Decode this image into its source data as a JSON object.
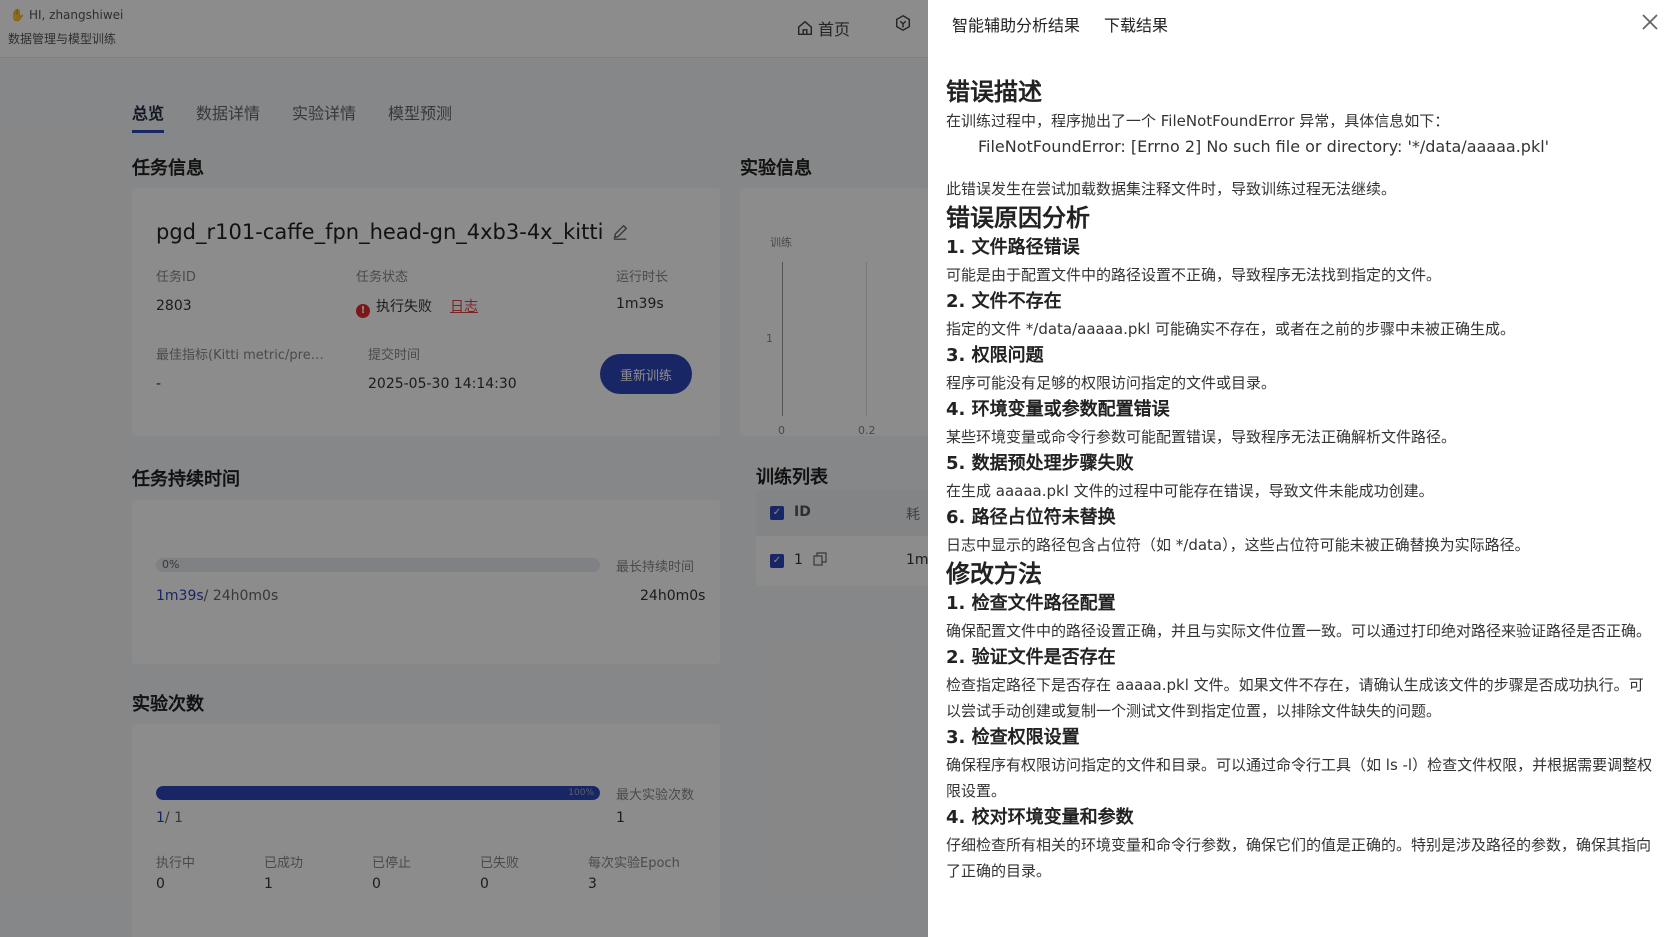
{
  "header": {
    "greeting": "HI, zhangshiwei",
    "subtitle": "数据管理与模型训练",
    "nav_home": "首页"
  },
  "tabs": [
    {
      "label": "总览",
      "active": true
    },
    {
      "label": "数据详情",
      "active": false
    },
    {
      "label": "实验详情",
      "active": false
    },
    {
      "label": "模型预测",
      "active": false
    }
  ],
  "task_info": {
    "section_title": "任务信息",
    "name": "pgd_r101-caffe_fpn_head-gn_4xb3-4x_kitti",
    "id_label": "任务ID",
    "id_value": "2803",
    "status_label": "任务状态",
    "status_value": "执行失败",
    "log_link": "日志",
    "runtime_label": "运行时长",
    "runtime_value": "1m39s",
    "best_metric_label": "最佳指标(Kitti metric/pre…",
    "best_metric_value": "-",
    "submit_label": "提交时间",
    "submit_value": "2025-05-30 14:14:30",
    "retrain_button": "重新训练"
  },
  "experiment_info": {
    "section_title": "实验信息",
    "chart_label": "训练",
    "y_tick": "1",
    "x_ticks": [
      "0",
      "0.2"
    ]
  },
  "duration": {
    "section_title": "任务持续时间",
    "progress_percent": 0,
    "progress_text": "0%",
    "max_label": "最长持续时间",
    "current": "1m39s",
    "separator": "/ 24h0m0s",
    "max_value": "24h0m0s"
  },
  "training_list": {
    "section_title": "训练列表",
    "col_id": "ID",
    "col_time": "耗",
    "row_id": "1",
    "row_time": "1m"
  },
  "experiment_count": {
    "section_title": "实验次数",
    "progress_percent": 100,
    "progress_text": "100%",
    "max_label": "最大实验次数",
    "current": "1",
    "separator": "/ 1",
    "max_value": "1",
    "stats": [
      {
        "label": "执行中",
        "value": "0"
      },
      {
        "label": "已成功",
        "value": "1"
      },
      {
        "label": "已停止",
        "value": "0"
      },
      {
        "label": "已失败",
        "value": "0"
      },
      {
        "label": "每次实验Epoch",
        "value": "3"
      }
    ]
  },
  "drawer": {
    "tabs": [
      "智能辅助分析结果",
      "下载结果"
    ],
    "sections": [
      {
        "type": "h1",
        "text": "错误描述"
      },
      {
        "type": "p",
        "text": "在训练过程中，程序抛出了一个 FileNotFoundError 异常，具体信息如下："
      },
      {
        "type": "code",
        "text": "FileNotFoundError: [Errno 2] No such file or directory: '*/data/aaaaa.pkl'"
      },
      {
        "type": "gap",
        "text": ""
      },
      {
        "type": "p",
        "text": "此错误发生在尝试加载数据集注释文件时，导致训练过程无法继续。"
      },
      {
        "type": "h1",
        "text": "错误原因分析"
      },
      {
        "type": "h2",
        "text": "1. 文件路径错误"
      },
      {
        "type": "p",
        "text": "可能是由于配置文件中的路径设置不正确，导致程序无法找到指定的文件。"
      },
      {
        "type": "h2",
        "text": "2. 文件不存在"
      },
      {
        "type": "p",
        "text": "指定的文件 */data/aaaaa.pkl 可能确实不存在，或者在之前的步骤中未被正确生成。"
      },
      {
        "type": "h2",
        "text": "3. 权限问题"
      },
      {
        "type": "p",
        "text": "程序可能没有足够的权限访问指定的文件或目录。"
      },
      {
        "type": "h2",
        "text": "4. 环境变量或参数配置错误"
      },
      {
        "type": "p",
        "text": "某些环境变量或命令行参数可能配置错误，导致程序无法正确解析文件路径。"
      },
      {
        "type": "h2",
        "text": "5. 数据预处理步骤失败"
      },
      {
        "type": "p",
        "text": "在生成 aaaaa.pkl 文件的过程中可能存在错误，导致文件未能成功创建。"
      },
      {
        "type": "h2",
        "text": "6. 路径占位符未替换"
      },
      {
        "type": "p",
        "text": "日志中显示的路径包含占位符（如 */data），这些占位符可能未被正确替换为实际路径。"
      },
      {
        "type": "h1",
        "text": "修改方法"
      },
      {
        "type": "h2",
        "text": "1. 检查文件路径配置"
      },
      {
        "type": "p",
        "text": "确保配置文件中的路径设置正确，并且与实际文件位置一致。可以通过打印绝对路径来验证路径是否正确。"
      },
      {
        "type": "h2",
        "text": "2. 验证文件是否存在"
      },
      {
        "type": "p",
        "text": "检查指定路径下是否存在 aaaaa.pkl 文件。如果文件不存在，请确认生成该文件的步骤是否成功执行。可以尝试手动创建或复制一个测试文件到指定位置，以排除文件缺失的问题。"
      },
      {
        "type": "h2",
        "text": "3. 检查权限设置"
      },
      {
        "type": "p",
        "text": "确保程序有权限访问指定的文件和目录。可以通过命令行工具（如 ls -l）检查文件权限，并根据需要调整权限设置。"
      },
      {
        "type": "h2",
        "text": "4. 校对环境变量和参数"
      },
      {
        "type": "p",
        "text": "仔细检查所有相关的环境变量和命令行参数，确保它们的值是正确的。特别是涉及路径的参数，确保其指向了正确的目录。"
      }
    ]
  }
}
